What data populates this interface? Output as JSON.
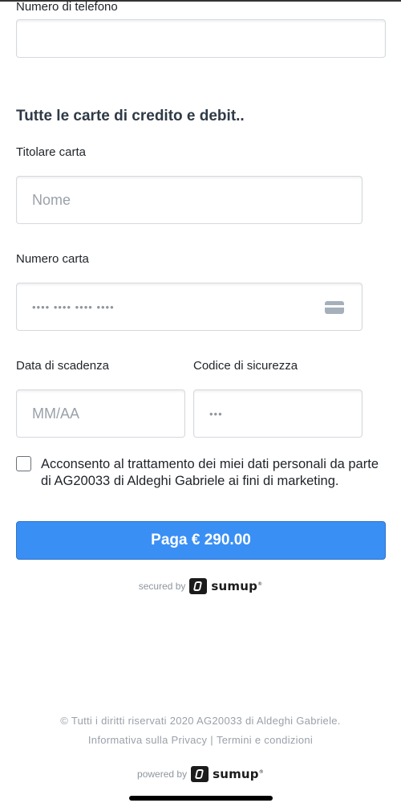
{
  "phone": {
    "label": "Numero di telefono",
    "value": ""
  },
  "section_title": "Tutte le carte di credito e debit..",
  "cardholder": {
    "label": "Titolare carta",
    "placeholder": "Nome"
  },
  "card_number": {
    "label": "Numero carta",
    "placeholder": "•••• •••• •••• ••••",
    "icon": "credit-card-icon"
  },
  "expiry": {
    "label": "Data di scadenza",
    "placeholder": "MM/AA"
  },
  "security_code": {
    "label": "Codice di sicurezza",
    "placeholder": "•••"
  },
  "consent": {
    "checked": false,
    "text": "Acconsento al trattamento dei miei dati personali da parte di AG20033 di Aldeghi Gabriele ai fini di marketing."
  },
  "pay_button": {
    "label": "Paga € 290.00"
  },
  "secured_by": {
    "prefix": "secured by",
    "brand": "sumup"
  },
  "footer": {
    "copyright": "© Tutti i diritti riservati 2020 AG20033 di Aldeghi Gabriele.",
    "privacy_link": "Informativa sulla Privacy",
    "separator": "|",
    "terms_link": "Termini e condizioni"
  },
  "powered_by": {
    "prefix": "powered by",
    "brand": "sumup"
  },
  "colors": {
    "accent": "#3a8ff5",
    "title": "#2f3a46",
    "muted": "#9aa1a9"
  }
}
